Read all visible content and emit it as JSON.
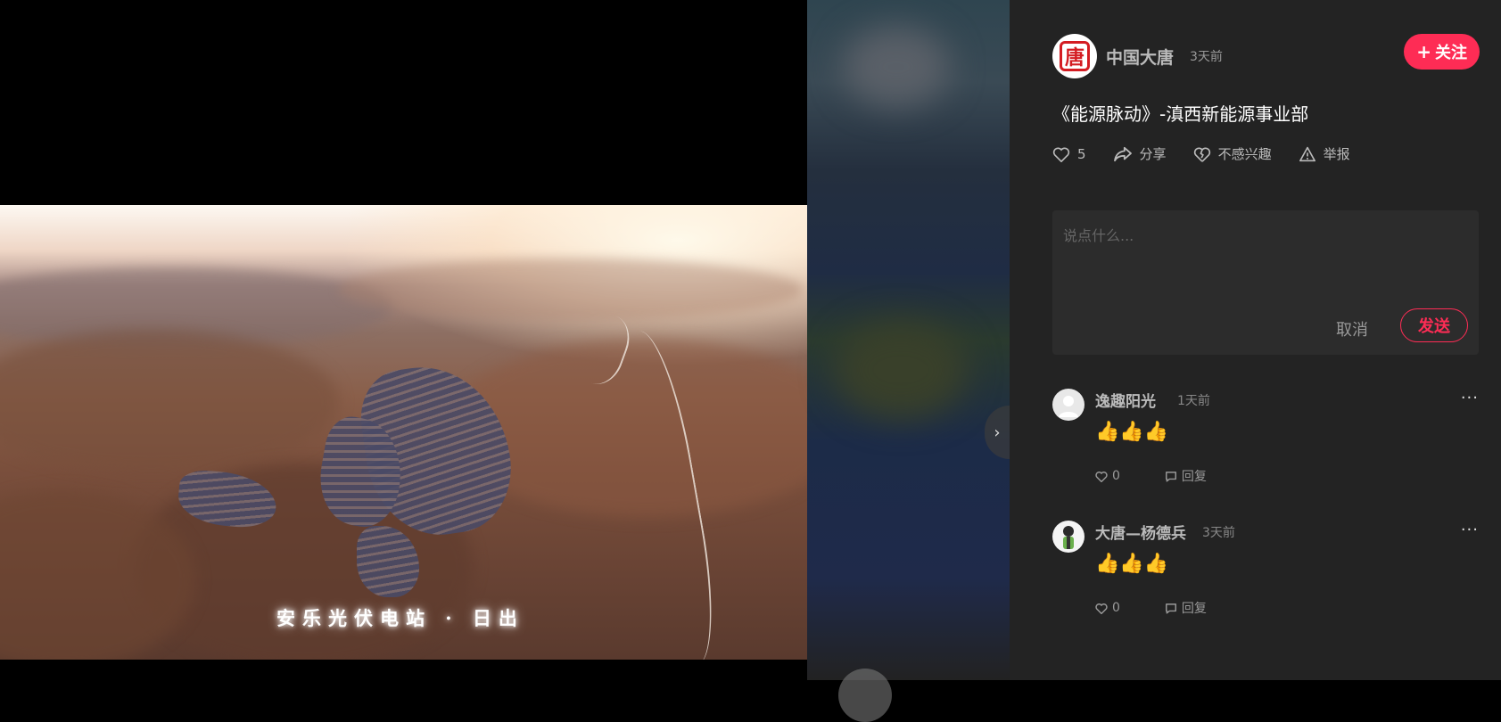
{
  "video": {
    "subtitle": "安乐光伏电站 · 日出"
  },
  "author": {
    "avatar_text": "唐",
    "name": "中国大唐",
    "time": "3天前",
    "follow_label": "关注"
  },
  "post": {
    "title": "《能源脉动》-滇西新能源事业部",
    "likes": "5",
    "share_label": "分享",
    "not_interested_label": "不感兴趣",
    "report_label": "举报"
  },
  "comment_box": {
    "placeholder": "说点什么...",
    "cancel_label": "取消",
    "send_label": "发送"
  },
  "comments": [
    {
      "name": "逸趣阳光",
      "time": "1天前",
      "text": "👍👍👍",
      "likes": "0",
      "reply_label": "回复"
    },
    {
      "name": "大唐—杨德兵",
      "time": "3天前",
      "text": "👍👍👍",
      "likes": "0",
      "reply_label": "回复"
    }
  ],
  "colors": {
    "accent": "#fe2c55",
    "panel_bg": "#232323",
    "logo_red": "#d41c22"
  }
}
